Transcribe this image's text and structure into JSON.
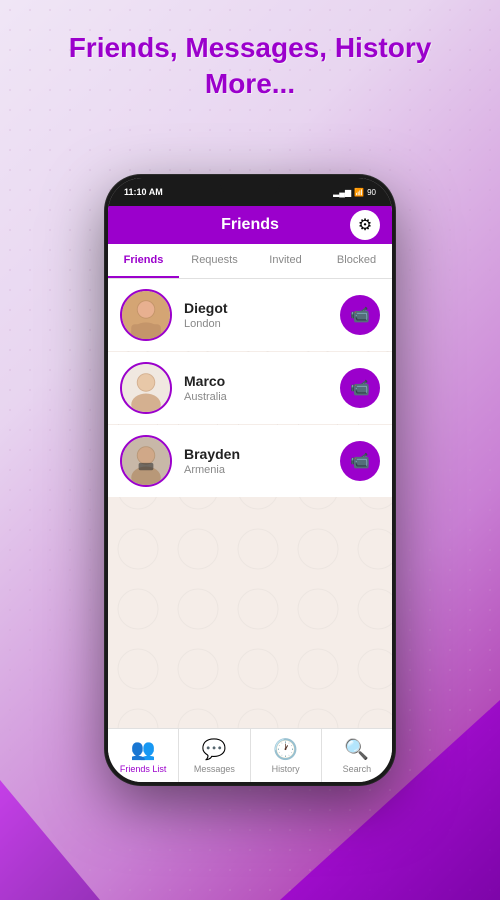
{
  "page": {
    "title_line1": "Friends, Messages, History",
    "title_line2": "More..."
  },
  "header": {
    "title": "Friends",
    "settings_icon": "⚙"
  },
  "status_bar": {
    "time": "11:10 AM"
  },
  "tabs": [
    {
      "label": "Friends",
      "active": true
    },
    {
      "label": "Requests",
      "active": false
    },
    {
      "label": "Invited",
      "active": false
    },
    {
      "label": "Blocked",
      "active": false
    }
  ],
  "friends": [
    {
      "name": "Diegot",
      "location": "London"
    },
    {
      "name": "Marco",
      "location": "Australia"
    },
    {
      "name": "Brayden",
      "location": "Armenia"
    }
  ],
  "bottom_nav": [
    {
      "label": "Friends List",
      "active": true
    },
    {
      "label": "Messages",
      "active": false
    },
    {
      "label": "History",
      "active": false
    },
    {
      "label": "Search",
      "active": false
    }
  ]
}
